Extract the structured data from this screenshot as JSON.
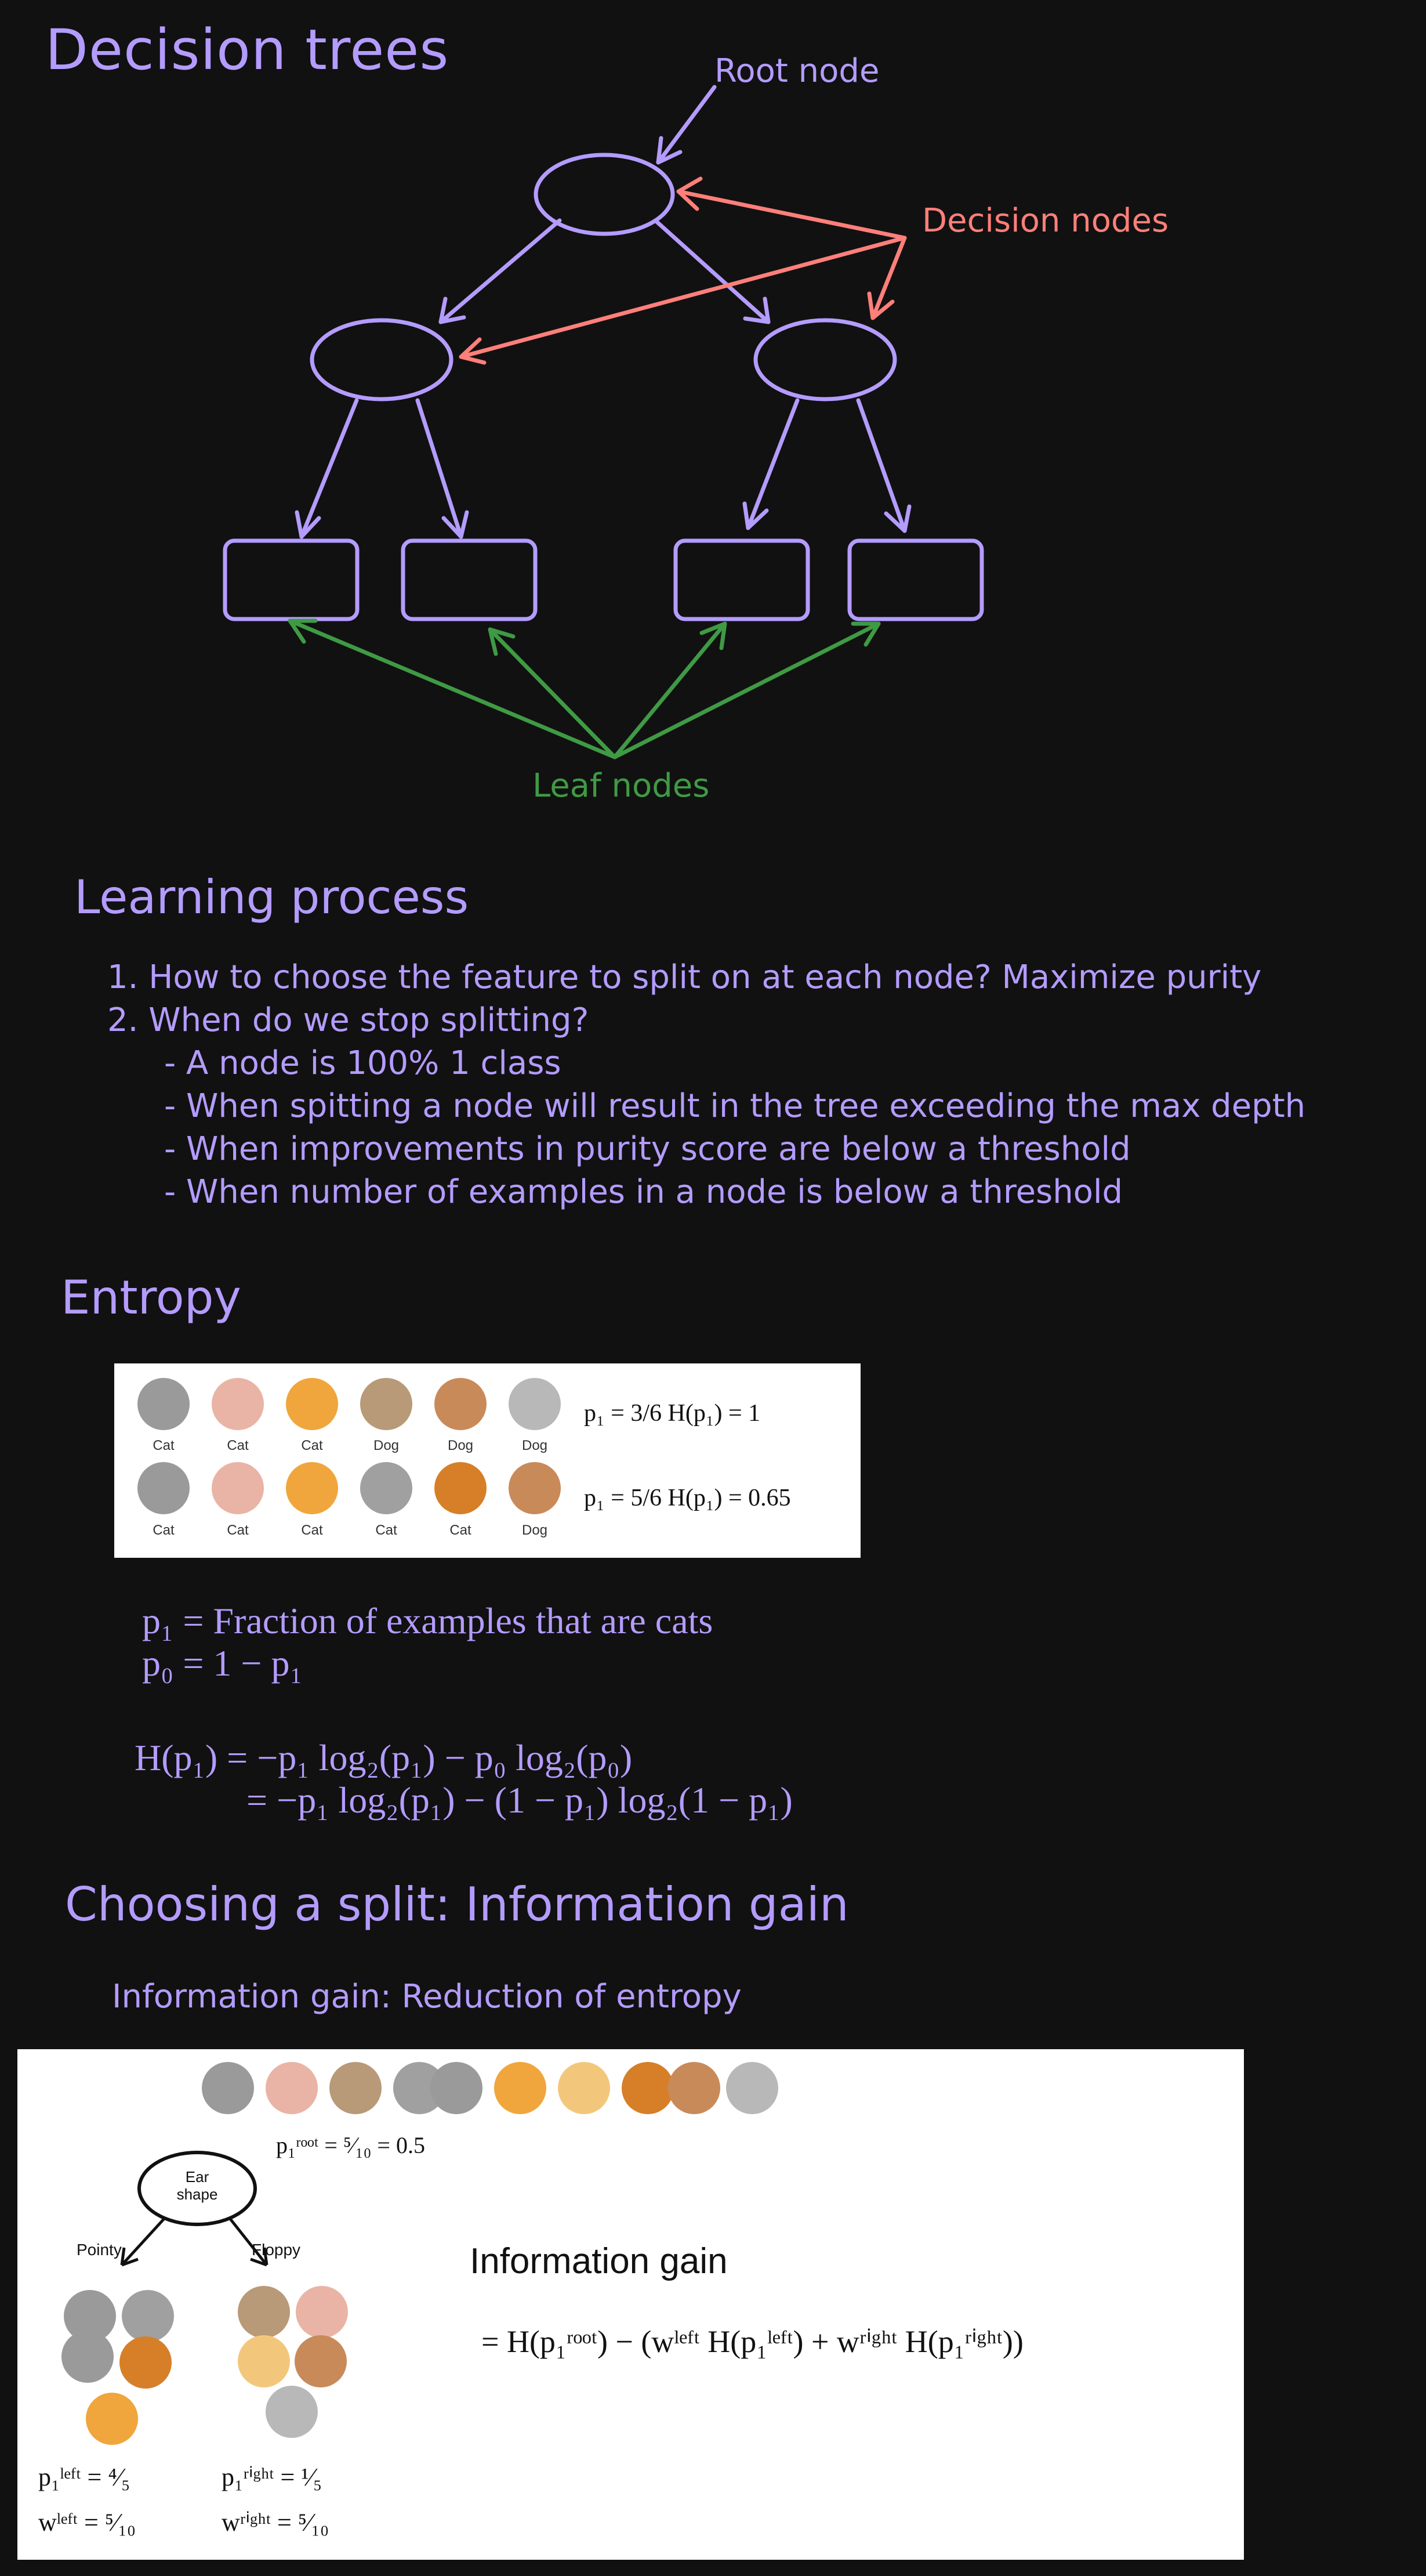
{
  "diagram": {
    "title": "Decision trees",
    "root_label": "Root node",
    "decision_label": "Decision nodes",
    "leaf_label": "Leaf nodes",
    "colors": {
      "tree": "#b49cff",
      "decision": "#ff7f7a",
      "leaf": "#3f9a44"
    }
  },
  "learning": {
    "heading": "Learning process",
    "items": [
      "1. How to choose the feature to split on at each node? Maximize purity",
      "2. When do we stop splitting?",
      "- A node is 100% 1 class",
      "- When spitting a node will result in the tree exceeding the max depth",
      "- When improvements in purity score are below a threshold",
      "- When number of examples in a node is below a threshold"
    ]
  },
  "entropy": {
    "heading": "Entropy",
    "row1_captions": [
      "Cat",
      "Cat",
      "Cat",
      "Dog",
      "Dog",
      "Dog"
    ],
    "row2_captions": [
      "Cat",
      "Cat",
      "Cat",
      "Cat",
      "Cat",
      "Dog"
    ],
    "row1_formula": "p₁ = 3/6   H(p₁) = 1",
    "row2_formula": "p₁ = 5/6   H(p₁) = 0.65",
    "def1": "p₁ = Fraction of examples that are cats",
    "def2": "p₀ = 1 − p₁",
    "eq1": "H(p₁) = −p₁ log₂(p₁) − p₀ log₂(p₀)",
    "eq2": "= −p₁ log₂(p₁) − (1 − p₁) log₂(1 − p₁)"
  },
  "split": {
    "heading": "Choosing a split: Information gain",
    "subheading": "Information gain: Reduction of entropy",
    "root_fraction": "p₁ʳᵒᵒᵗ = ⁵⁄₁₀ = 0.5",
    "node_label": "Ear shape",
    "branch_left": "Pointy",
    "branch_right": "Floppy",
    "ig_title": "Information gain",
    "ig_formula": "= H(p₁ʳᵒᵒᵗ) − (wˡᵉᶠᵗ H(p₁ˡᵉᶠᵗ) + wʳⁱᵍʰᵗ H(p₁ʳⁱᵍʰᵗ))",
    "p_left": "p₁ˡᵉᶠᵗ = ⁴⁄₅",
    "w_left": "wˡᵉᶠᵗ = ⁵⁄₁₀",
    "p_right": "p₁ʳⁱᵍʰᵗ = ¹⁄₅",
    "w_right": "wʳⁱᵍʰᵗ = ⁵⁄₁₀"
  }
}
